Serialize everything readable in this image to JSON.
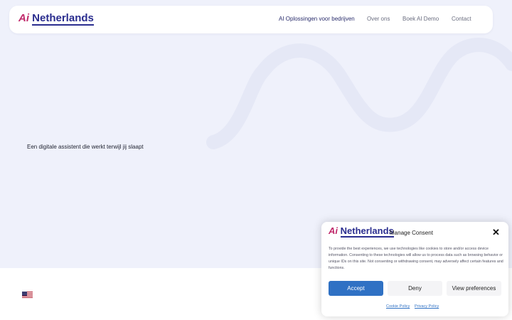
{
  "brand": {
    "ai": "Ai",
    "name": "Netherlands"
  },
  "nav": {
    "items": [
      {
        "label": "AI Oplossingen voor bedrijven"
      },
      {
        "label": "Over ons"
      },
      {
        "label": "Boek AI Demo"
      },
      {
        "label": "Contact"
      }
    ]
  },
  "hero": {
    "tagline": "Een digitale assistent die werkt terwijl jij slaapt"
  },
  "language": {
    "icon": "us-flag-icon"
  },
  "consent": {
    "title": "Manage Consent",
    "close_icon": "close-icon",
    "body": "To provide the best experiences, we use technologies like cookies to store and/or access device information. Consenting to these technologies will allow us to process data such as browsing behavior or unique IDs on this site. Not consenting or withdrawing consent, may adversely affect certain features and functions.",
    "accept_label": "Accept",
    "deny_label": "Deny",
    "preferences_label": "View preferences",
    "cookie_policy_label": "Cookie Policy",
    "privacy_policy_label": "Privacy Policy"
  },
  "colors": {
    "brand_accent": "#c02a6b",
    "brand_primary": "#2a2d8f",
    "hero_background": "#eff1fb",
    "accept_button": "#2f71c4"
  }
}
